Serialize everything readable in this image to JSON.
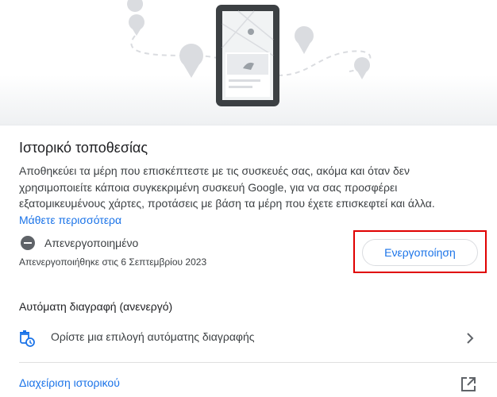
{
  "title": "Ιστορικό τοποθεσίας",
  "description": "Αποθηκεύει τα μέρη που επισκέπτεστε με τις συσκευές σας, ακόμα και όταν δεν χρησιμοποιείτε κάποια συγκεκριμένη συσκευή Google, για να σας προσφέρει εξατομικευμένους χάρτες, προτάσεις με βάση τα μέρη που έχετε επισκεφτεί και άλλα.",
  "learn_more": "Μάθετε περισσότερα",
  "status": {
    "label": "Απενεργοποιημένο",
    "date": "Απενεργοποιήθηκε στις 6 Σεπτεμβρίου 2023",
    "icon": "remove-circle-icon"
  },
  "enable_button": "Ενεργοποίηση",
  "auto_delete": {
    "heading": "Αυτόματη διαγραφή (ανενεργό)",
    "option": "Ορίστε μια επιλογή αυτόματης διαγραφής",
    "icon": "auto-delete-icon"
  },
  "manage_history": "Διαχείριση ιστορικού",
  "colors": {
    "link": "#1a73e8",
    "highlight": "#e00000",
    "text": "#202124"
  }
}
